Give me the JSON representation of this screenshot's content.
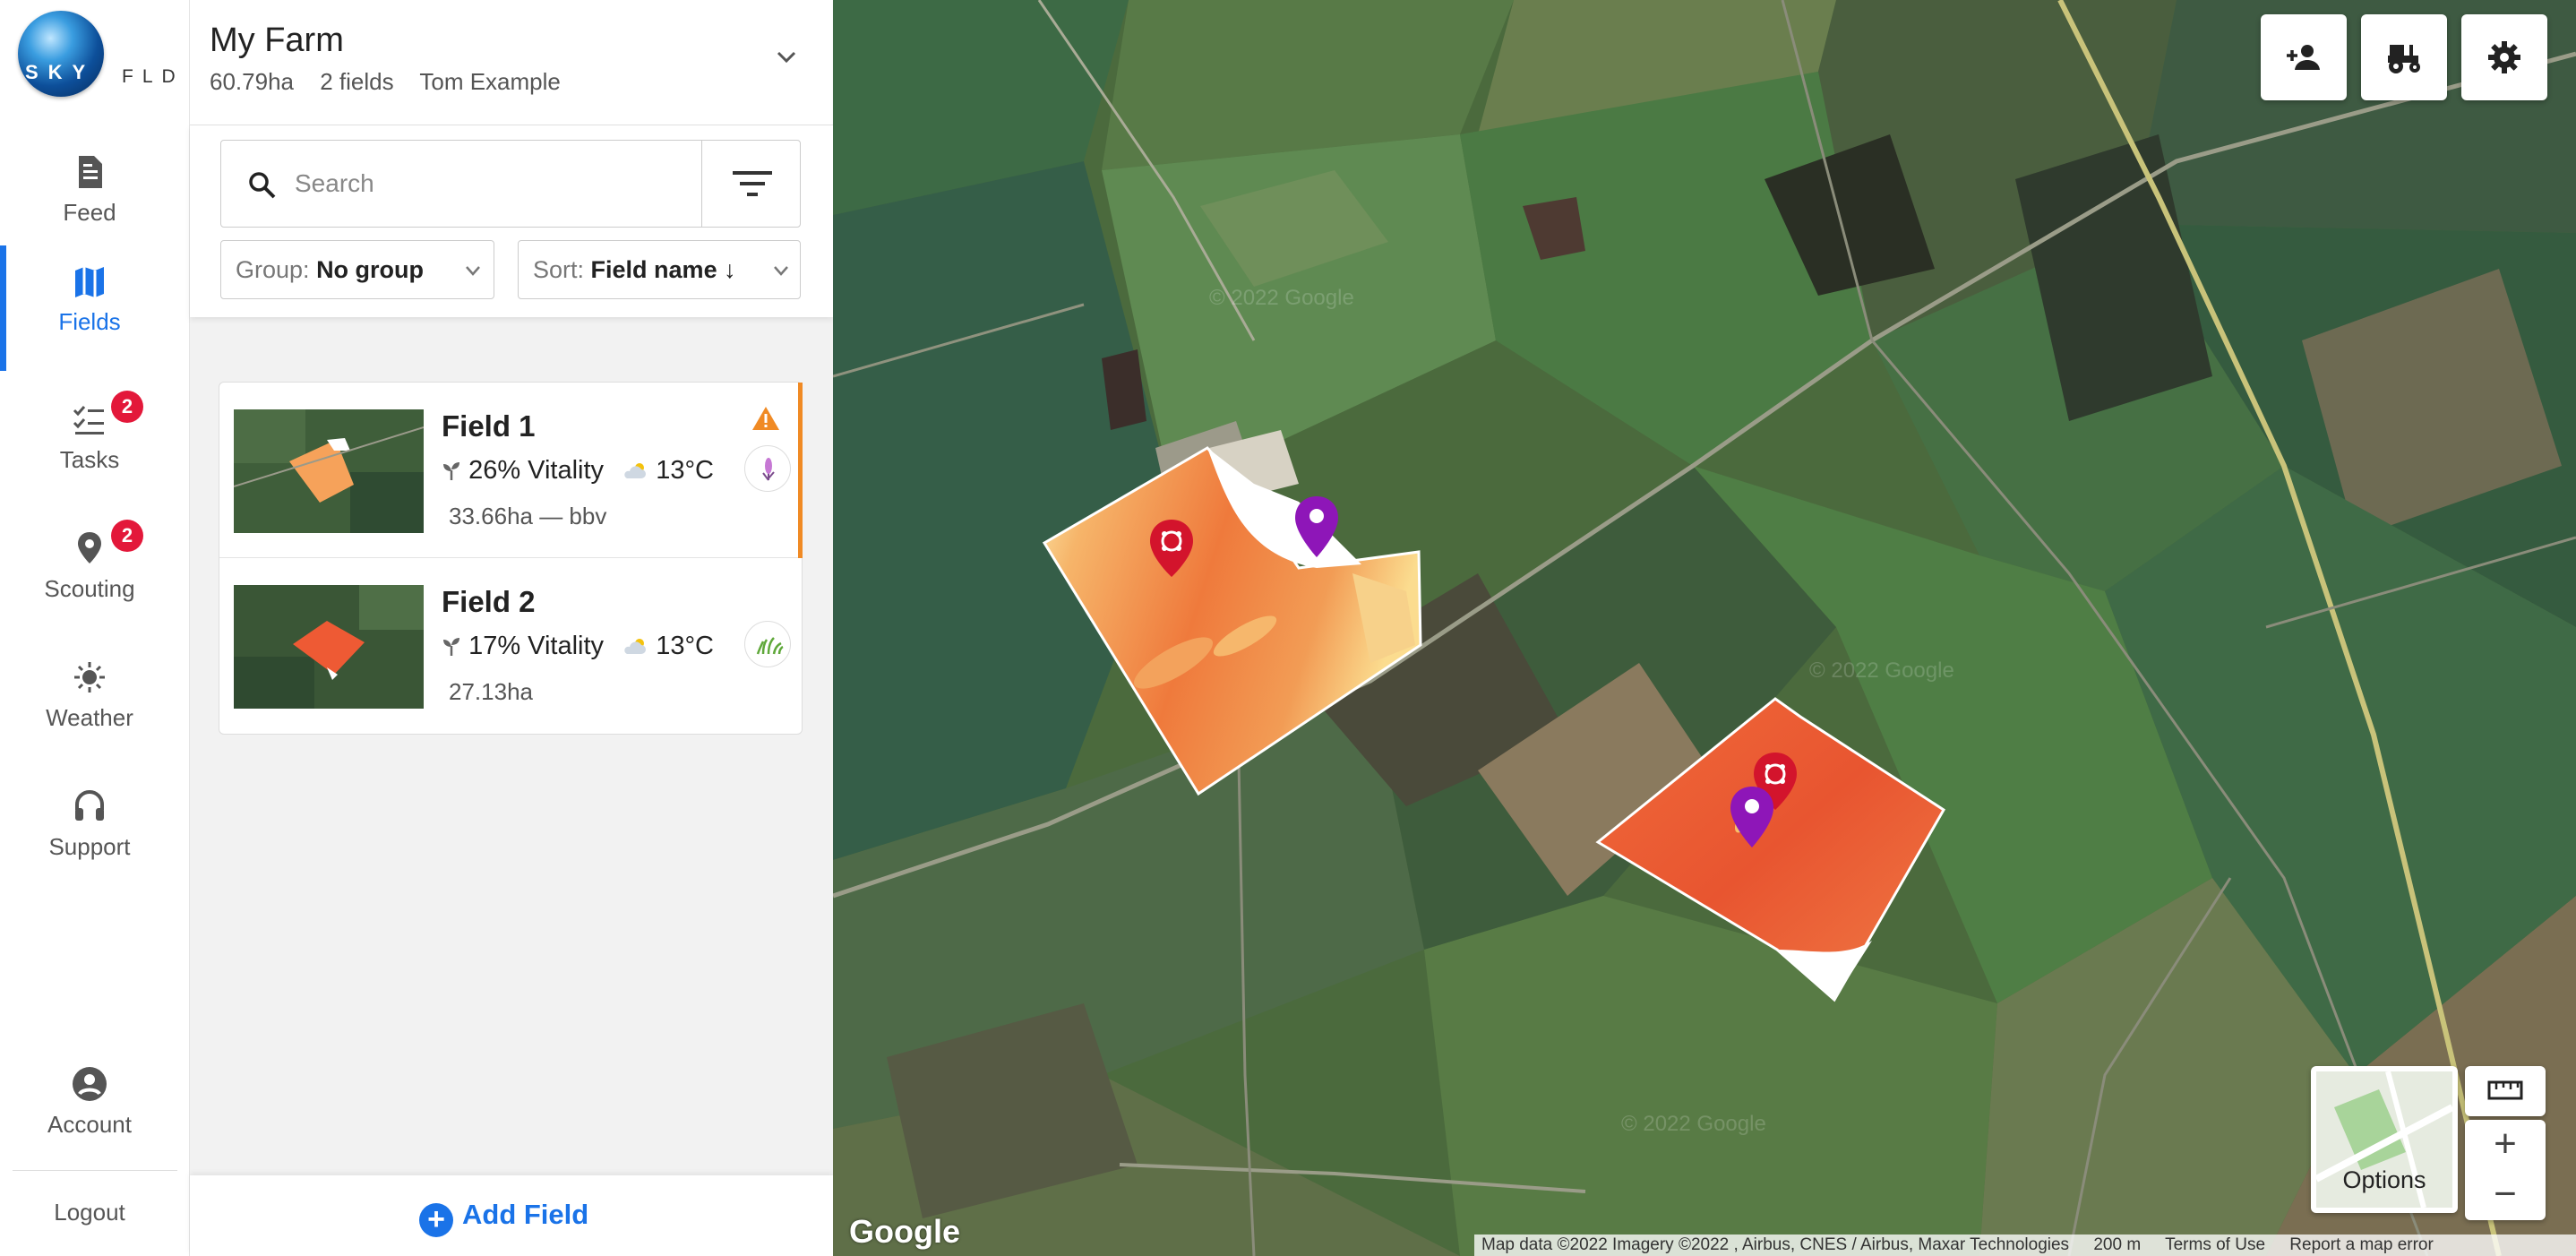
{
  "brand": {
    "logo_text": "SKYFLD",
    "logo_left": "SKY",
    "logo_right": "FLD"
  },
  "nav": {
    "feed": "Feed",
    "fields": "Fields",
    "tasks": "Tasks",
    "tasks_badge": "2",
    "scouting": "Scouting",
    "scouting_badge": "2",
    "weather": "Weather",
    "support": "Support",
    "account": "Account",
    "logout": "Logout"
  },
  "farm": {
    "name": "My Farm",
    "area": "60.79ha",
    "fields_count": "2 fields",
    "owner": "Tom Example"
  },
  "search": {
    "placeholder": "Search"
  },
  "group": {
    "label": "Group:",
    "value": "No group"
  },
  "sort": {
    "label": "Sort:",
    "value": "Field name",
    "direction_glyph": "↓"
  },
  "fields": [
    {
      "name": "Field 1",
      "vitality": "26% Vitality",
      "temp": "13°C",
      "size": "33.66ha — bbv",
      "warning": true,
      "crop_icon": "wheat-icon"
    },
    {
      "name": "Field 2",
      "vitality": "17% Vitality",
      "temp": "13°C",
      "size": "27.13ha",
      "warning": false,
      "crop_icon": "grass-icon"
    }
  ],
  "add_field": "Add Field",
  "map": {
    "options": "Options",
    "google": "Google",
    "attribution": "Map data ©2022 Imagery ©2022 , Airbus, CNES / Airbus, Maxar Technologies",
    "scale": "200 m",
    "terms": "Terms of Use",
    "report": "Report a map error",
    "watermark": "© 2022 Google"
  },
  "colors": {
    "accent": "#1a73e8",
    "badge": "#e3183a",
    "warning": "#f08a24",
    "ndvi_high": "#f5d27a",
    "ndvi_low": "#e8552f",
    "pin_purple": "#8e16b8",
    "pin_red": "#d3142c"
  }
}
